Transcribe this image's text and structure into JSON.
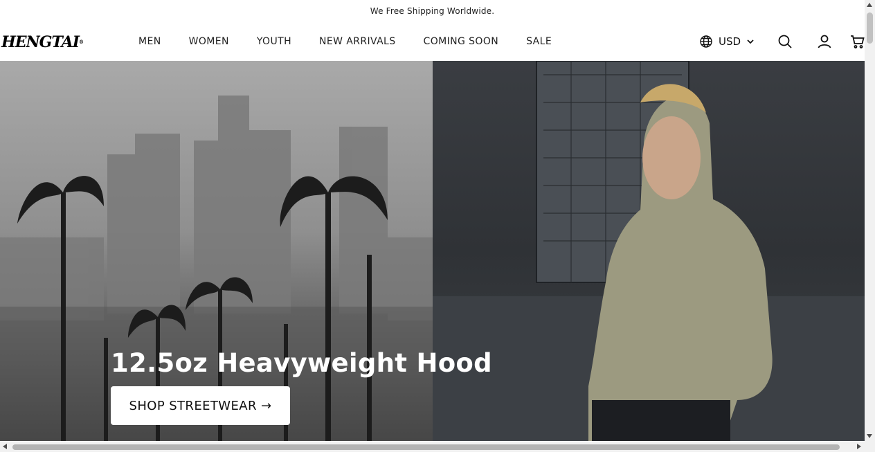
{
  "announcement": {
    "text": "We Free Shipping Worldwide."
  },
  "header": {
    "logo": "HENGTAI",
    "logo_mark": "®",
    "nav": [
      "MEN",
      "WOMEN",
      "YOUTH",
      "NEW ARRIVALS",
      "COMING SOON",
      "SALE"
    ],
    "currency": "USD",
    "icons": [
      "globe-icon",
      "chevron-down-icon",
      "search-icon",
      "account-icon",
      "cart-icon"
    ]
  },
  "hero": {
    "headline": "12.5oz Heavyweight Hood",
    "cta_label": "SHOP STREETWEAR →",
    "colors": {
      "text": "#ffffff",
      "button_bg": "#ffffff",
      "button_text": "#111111",
      "hoodie": "#9c9a80"
    }
  }
}
